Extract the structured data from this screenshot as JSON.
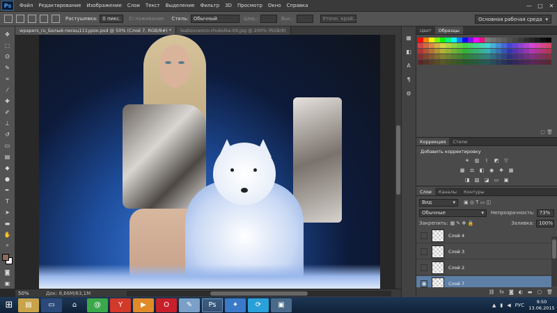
{
  "app": {
    "logo": "Ps"
  },
  "menu": [
    "Файл",
    "Редактирование",
    "Изображение",
    "Слои",
    "Текст",
    "Выделение",
    "Фильтр",
    "3D",
    "Просмотр",
    "Окно",
    "Справка"
  ],
  "window_controls": [
    "—",
    "□",
    "✕"
  ],
  "options": {
    "feather_label": "Растушевка:",
    "feather_value": "0 пикс.",
    "antialias_label": "Сглаживание",
    "style_label": "Стиль:",
    "style_value": "Обычный",
    "width_label": "Шир.:",
    "height_label": "Выс.:",
    "refine_label": "Уточн. край...",
    "workspace": "Основная рабочая среда"
  },
  "documents": {
    "tabs": [
      {
        "label": "wpapers_ru_Белый-песец111урок.psd @ 50% (Слой 7, RGB/8#) *",
        "active": true
      },
      {
        "label": "leabovcenco-chukolka-09.jpg @ 200% (RGB/8)",
        "active": false
      }
    ]
  },
  "status": {
    "zoom": "50%",
    "doc": "Док: 8,66M/63,1M"
  },
  "panels": {
    "swatch_tabs": [
      "Цвет",
      "Образцы"
    ],
    "adjust_tabs": [
      "Коррекция",
      "Стили"
    ],
    "adjust_title": "Добавить корректировку",
    "layers_tabs": [
      "Слои",
      "Каналы",
      "Контуры"
    ],
    "kind_filter": "Вид",
    "blend_mode": "Обычные",
    "opacity_label": "Непрозрачность:",
    "opacity_value": "73%",
    "lock_label": "Закрепить:",
    "fill_label": "Заливка:",
    "fill_value": "100%",
    "layers": [
      {
        "name": "Слой 4",
        "selected": false
      },
      {
        "name": "Слой 3",
        "selected": false
      },
      {
        "name": "Слой 2",
        "selected": false
      },
      {
        "name": "Слой 7",
        "selected": true
      }
    ]
  },
  "taskbar": {
    "lang": "РУС",
    "time": "9:50",
    "date": "13.06.2015"
  },
  "colors": {
    "foreground": "#8a6a5e",
    "background": "#ffffff",
    "selection": "#5d7fa6"
  }
}
